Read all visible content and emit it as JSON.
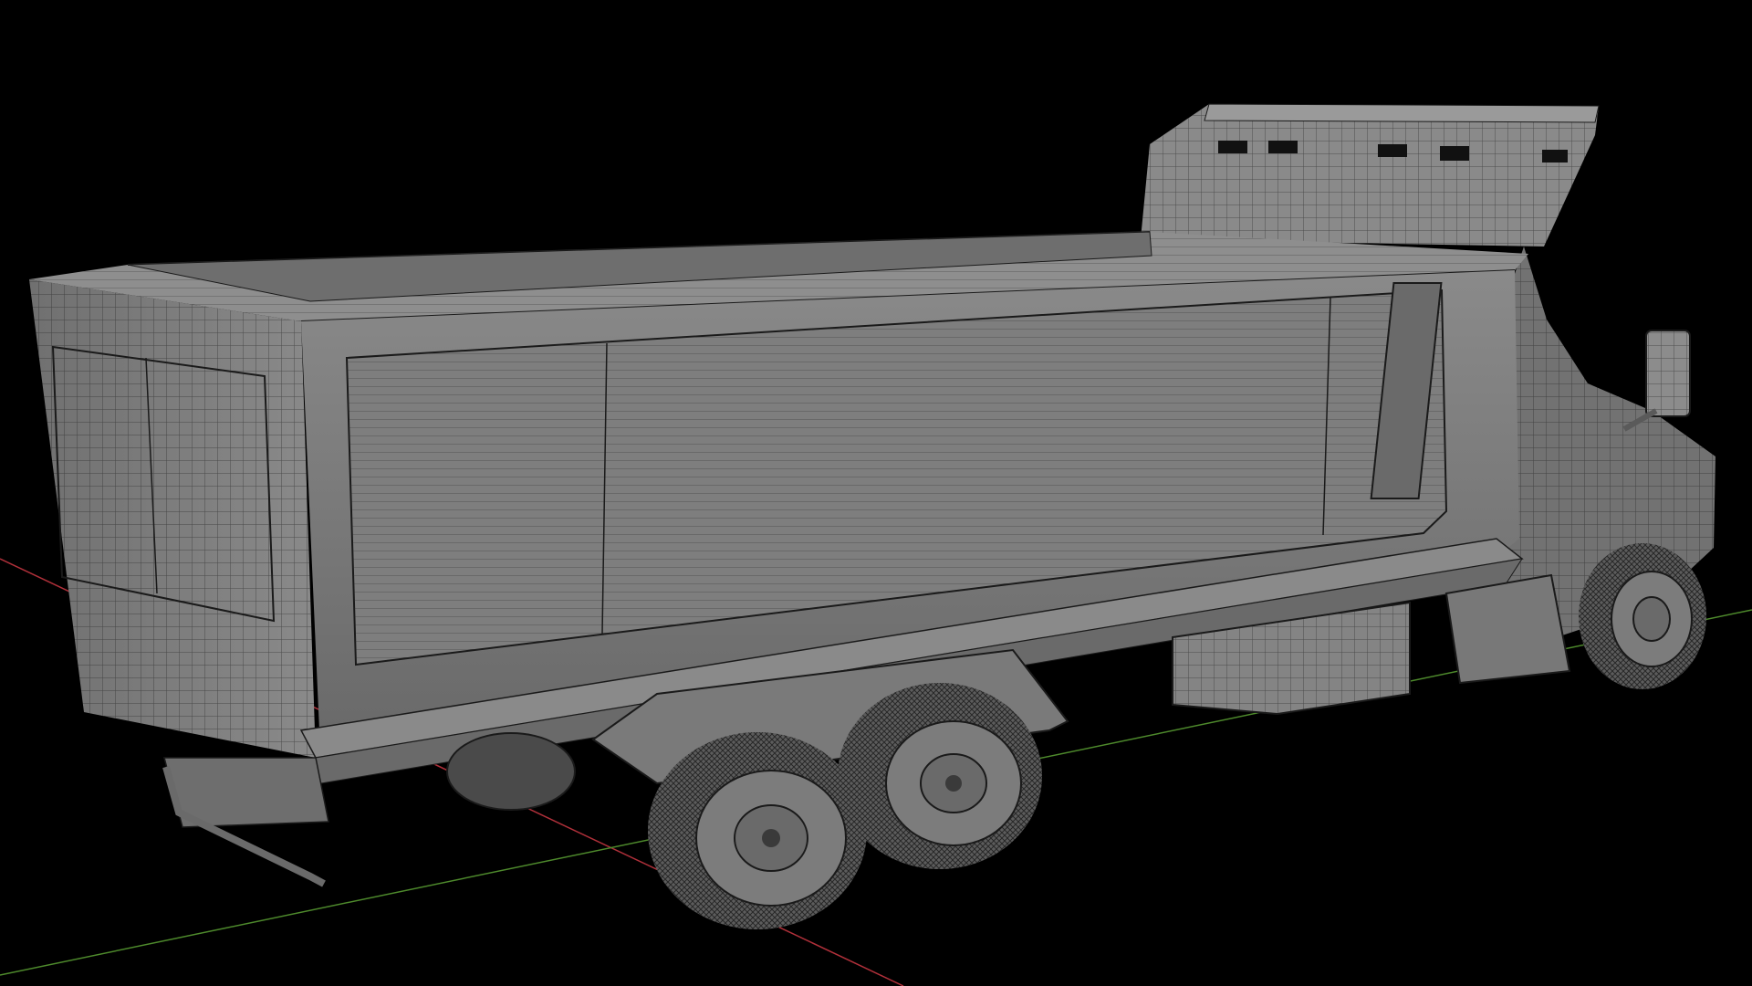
{
  "viewport": {
    "background": "#000000",
    "axis_x_color": "#b0303a",
    "axis_y_color": "#4e8a2c",
    "mesh_fill": "#7c7c7c",
    "mesh_fill_dark": "#5e5e5e",
    "mesh_fill_light": "#8e8e8e",
    "wire_color": "#1a1a1a",
    "icons": [
      "truck-model-icon"
    ]
  }
}
